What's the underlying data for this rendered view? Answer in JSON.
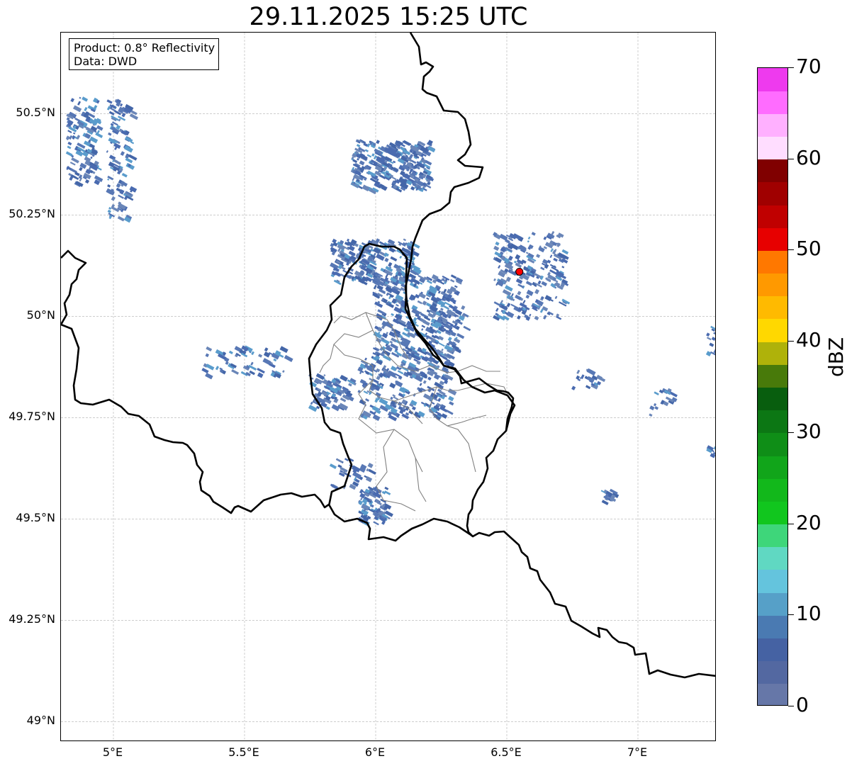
{
  "title": "29.11.2025 15:25 UTC",
  "info": {
    "product": "Product: 0.8° Reflectivity",
    "data": "Data: DWD"
  },
  "axes": {
    "lat_labels": [
      {
        "value": 50.5,
        "label": "50.5°N"
      },
      {
        "value": 50.25,
        "label": "50.25°N"
      },
      {
        "value": 50.0,
        "label": "50°N"
      },
      {
        "value": 49.75,
        "label": "49.75°N"
      },
      {
        "value": 49.5,
        "label": "49.5°N"
      },
      {
        "value": 49.25,
        "label": "49.25°N"
      },
      {
        "value": 49.0,
        "label": "49°N"
      }
    ],
    "lon_labels": [
      {
        "value": 5.0,
        "label": "5°E"
      },
      {
        "value": 5.5,
        "label": "5.5°E"
      },
      {
        "value": 6.0,
        "label": "6°E"
      },
      {
        "value": 6.5,
        "label": "6.5°E"
      },
      {
        "value": 7.0,
        "label": "7°E"
      }
    ],
    "lon_range": [
      4.8,
      7.3
    ],
    "lat_range": [
      48.95,
      50.7
    ]
  },
  "radar_site": {
    "lon": 6.548,
    "lat": 50.11,
    "color": "#ff0000"
  },
  "colorbar": {
    "unit": "dBZ",
    "min": 0,
    "max": 70,
    "tick_labels": [
      "0",
      "10",
      "20",
      "30",
      "40",
      "50",
      "60",
      "70"
    ],
    "tick_values": [
      0,
      10,
      20,
      30,
      40,
      50,
      60,
      70
    ],
    "levels": [
      {
        "from": 0,
        "to": 2.5,
        "color": "#6677a8"
      },
      {
        "from": 2.5,
        "to": 5,
        "color": "#5368a1"
      },
      {
        "from": 5,
        "to": 7.5,
        "color": "#4562a3"
      },
      {
        "from": 7.5,
        "to": 10,
        "color": "#4a7ab2"
      },
      {
        "from": 10,
        "to": 12.5,
        "color": "#56a0c8"
      },
      {
        "from": 12.5,
        "to": 15,
        "color": "#64c4dd"
      },
      {
        "from": 15,
        "to": 17.5,
        "color": "#60d8c2"
      },
      {
        "from": 17.5,
        "to": 20,
        "color": "#3ed67a"
      },
      {
        "from": 20,
        "to": 22.5,
        "color": "#11c61e"
      },
      {
        "from": 22.5,
        "to": 25,
        "color": "#12b81b"
      },
      {
        "from": 25,
        "to": 27.5,
        "color": "#11a51a"
      },
      {
        "from": 27.5,
        "to": 30,
        "color": "#0f8e17"
      },
      {
        "from": 30,
        "to": 32.5,
        "color": "#0c7714"
      },
      {
        "from": 32.5,
        "to": 35,
        "color": "#085e0e"
      },
      {
        "from": 35,
        "to": 37.5,
        "color": "#487a0a"
      },
      {
        "from": 37.5,
        "to": 40,
        "color": "#afb20a"
      },
      {
        "from": 40,
        "to": 42.5,
        "color": "#ffd800"
      },
      {
        "from": 42.5,
        "to": 45,
        "color": "#ffba00"
      },
      {
        "from": 45,
        "to": 47.5,
        "color": "#ff9900"
      },
      {
        "from": 47.5,
        "to": 50,
        "color": "#ff7800"
      },
      {
        "from": 50,
        "to": 52.5,
        "color": "#e70000"
      },
      {
        "from": 52.5,
        "to": 55,
        "color": "#c00000"
      },
      {
        "from": 55,
        "to": 57.5,
        "color": "#a00000"
      },
      {
        "from": 57.5,
        "to": 60,
        "color": "#800000"
      },
      {
        "from": 60,
        "to": 62.5,
        "color": "#ffddff"
      },
      {
        "from": 62.5,
        "to": 65,
        "color": "#ffb0ff"
      },
      {
        "from": 65,
        "to": 67.5,
        "color": "#ff6cff"
      },
      {
        "from": 67.5,
        "to": 70,
        "color": "#ee3aee"
      }
    ]
  },
  "colors": {
    "border": "#000000",
    "admin": "#808080",
    "grid": "#b0b0b0"
  }
}
